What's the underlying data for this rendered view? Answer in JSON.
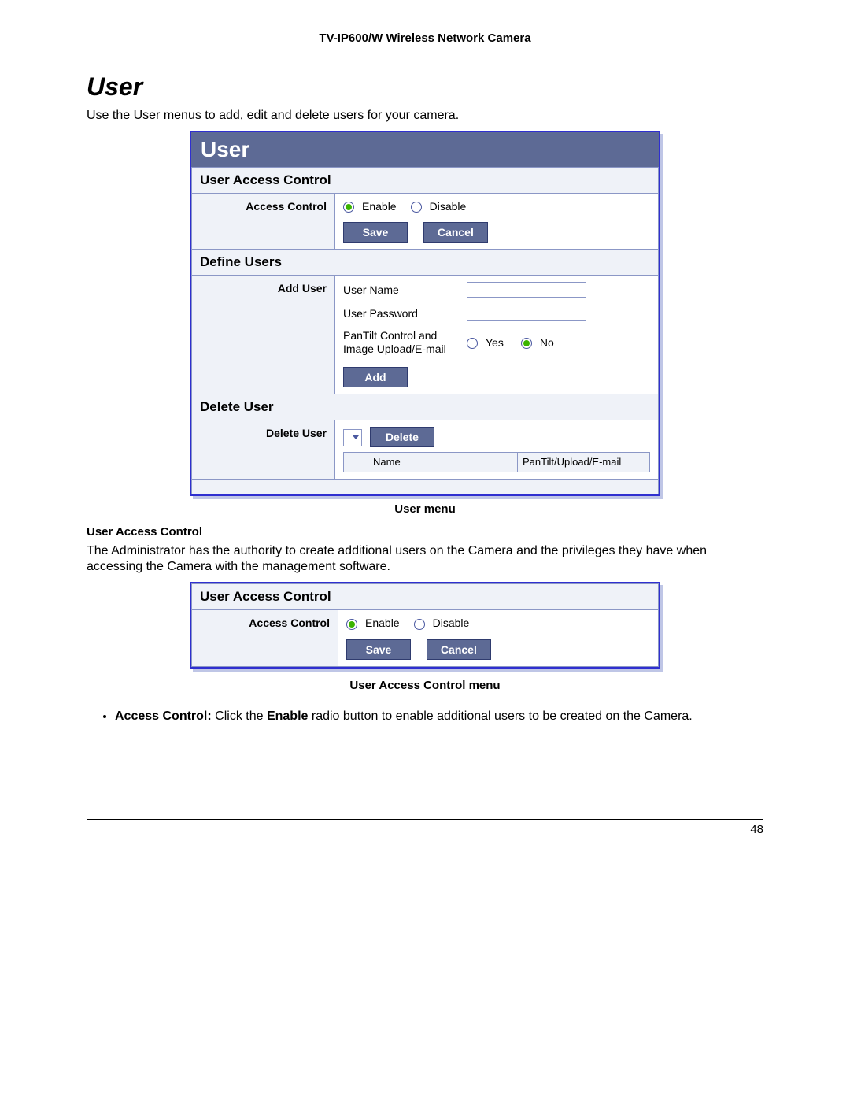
{
  "doc_header": "TV-IP600/W Wireless Network Camera",
  "section_title": "User",
  "intro": "Use the User menus to add, edit and delete users for your camera.",
  "caption1": "User menu",
  "sub1_title": "User Access Control",
  "sub1_body": "The Administrator has the authority to create additional users on the Camera and the privileges they have when accessing the Camera with the management software.",
  "caption2": "User Access Control menu",
  "bullet1_bold1": "Access Control:",
  "bullet1_text1": " Click the ",
  "bullet1_bold2": "Enable",
  "bullet1_text2": " radio button to enable additional users to be created on the Camera.",
  "page_num": "48",
  "ui1": {
    "title": "User",
    "s1": {
      "header": "User Access Control",
      "label": "Access Control",
      "opt_enable": "Enable",
      "opt_disable": "Disable",
      "btn_save": "Save",
      "btn_cancel": "Cancel"
    },
    "s2": {
      "header": "Define Users",
      "label": "Add User",
      "f_username": "User Name",
      "f_password": "User Password",
      "f_pantilt": "PanTilt Control and Image Upload/E-mail",
      "opt_yes": "Yes",
      "opt_no": "No",
      "btn_add": "Add"
    },
    "s3": {
      "header": "Delete User",
      "label": "Delete User",
      "btn_delete": "Delete",
      "col_name": "Name",
      "col_pan": "PanTilt/Upload/E-mail"
    }
  }
}
